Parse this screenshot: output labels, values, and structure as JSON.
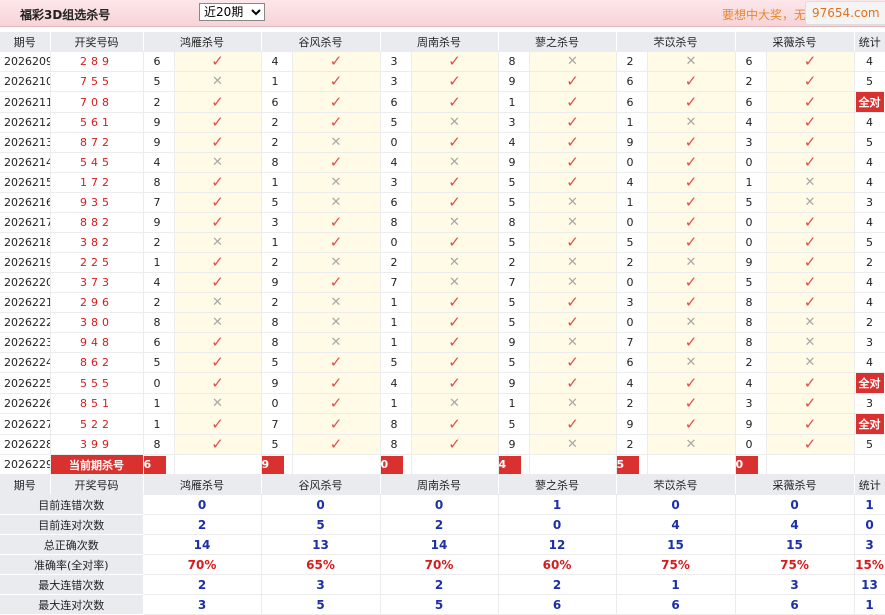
{
  "title": "福彩3D组选杀号",
  "period_options": [
    "近20期"
  ],
  "period_selected": "近20期",
  "slogan": "要想中大奖，无",
  "site_badge": "97654.com",
  "colors": {
    "check": "#e04e4e",
    "cross": "#a8a8a8",
    "highlight": "#d9312f",
    "stat_value": "#1c2fa7",
    "rate": "#d71b1b"
  },
  "headers": {
    "issue": "期号",
    "numbers": "开奖号码",
    "experts": [
      "鸿雁杀号",
      "谷风杀号",
      "周南杀号",
      "蓼之杀号",
      "芣苡杀号",
      "采薇杀号"
    ],
    "stat": "统计"
  },
  "rows": [
    {
      "issue": "2026209",
      "numbers": "289",
      "kills": [
        "6",
        "4",
        "3",
        "8",
        "2",
        "6"
      ],
      "hits": [
        1,
        1,
        1,
        0,
        0,
        1
      ],
      "stat": "4"
    },
    {
      "issue": "2026210",
      "numbers": "755",
      "kills": [
        "5",
        "1",
        "3",
        "9",
        "6",
        "2"
      ],
      "hits": [
        0,
        1,
        1,
        1,
        1,
        1
      ],
      "stat": "5"
    },
    {
      "issue": "2026211",
      "numbers": "708",
      "kills": [
        "2",
        "6",
        "6",
        "1",
        "6",
        "6"
      ],
      "hits": [
        1,
        1,
        1,
        1,
        1,
        1
      ],
      "stat": "全对"
    },
    {
      "issue": "2026212",
      "numbers": "561",
      "kills": [
        "9",
        "2",
        "5",
        "3",
        "1",
        "4"
      ],
      "hits": [
        1,
        1,
        0,
        1,
        0,
        1
      ],
      "stat": "4"
    },
    {
      "issue": "2026213",
      "numbers": "872",
      "kills": [
        "9",
        "2",
        "0",
        "4",
        "9",
        "3"
      ],
      "hits": [
        1,
        0,
        1,
        1,
        1,
        1
      ],
      "stat": "5"
    },
    {
      "issue": "2026214",
      "numbers": "545",
      "kills": [
        "4",
        "8",
        "4",
        "9",
        "0",
        "0"
      ],
      "hits": [
        0,
        1,
        0,
        1,
        1,
        1
      ],
      "stat": "4"
    },
    {
      "issue": "2026215",
      "numbers": "172",
      "kills": [
        "8",
        "1",
        "3",
        "5",
        "4",
        "1"
      ],
      "hits": [
        1,
        0,
        1,
        1,
        1,
        0
      ],
      "stat": "4"
    },
    {
      "issue": "2026216",
      "numbers": "935",
      "kills": [
        "7",
        "5",
        "6",
        "5",
        "1",
        "5"
      ],
      "hits": [
        1,
        0,
        1,
        0,
        1,
        0
      ],
      "stat": "3"
    },
    {
      "issue": "2026217",
      "numbers": "882",
      "kills": [
        "9",
        "3",
        "8",
        "8",
        "0",
        "0"
      ],
      "hits": [
        1,
        1,
        0,
        0,
        1,
        1
      ],
      "stat": "4"
    },
    {
      "issue": "2026218",
      "numbers": "382",
      "kills": [
        "2",
        "1",
        "0",
        "5",
        "5",
        "0"
      ],
      "hits": [
        0,
        1,
        1,
        1,
        1,
        1
      ],
      "stat": "5"
    },
    {
      "issue": "2026219",
      "numbers": "225",
      "kills": [
        "1",
        "2",
        "2",
        "2",
        "2",
        "9"
      ],
      "hits": [
        1,
        0,
        0,
        0,
        0,
        1
      ],
      "stat": "2"
    },
    {
      "issue": "2026220",
      "numbers": "373",
      "kills": [
        "4",
        "9",
        "7",
        "7",
        "0",
        "5"
      ],
      "hits": [
        1,
        1,
        0,
        0,
        1,
        1
      ],
      "stat": "4"
    },
    {
      "issue": "2026221",
      "numbers": "296",
      "kills": [
        "2",
        "2",
        "1",
        "5",
        "3",
        "8"
      ],
      "hits": [
        0,
        0,
        1,
        1,
        1,
        1
      ],
      "stat": "4"
    },
    {
      "issue": "2026222",
      "numbers": "380",
      "kills": [
        "8",
        "8",
        "1",
        "5",
        "0",
        "8"
      ],
      "hits": [
        0,
        0,
        1,
        1,
        0,
        0
      ],
      "stat": "2"
    },
    {
      "issue": "2026223",
      "numbers": "948",
      "kills": [
        "6",
        "8",
        "1",
        "9",
        "7",
        "8"
      ],
      "hits": [
        1,
        0,
        1,
        0,
        1,
        0
      ],
      "stat": "3"
    },
    {
      "issue": "2026224",
      "numbers": "862",
      "kills": [
        "5",
        "5",
        "5",
        "5",
        "6",
        "2"
      ],
      "hits": [
        1,
        1,
        1,
        1,
        0,
        0
      ],
      "stat": "4"
    },
    {
      "issue": "2026225",
      "numbers": "555",
      "kills": [
        "0",
        "9",
        "4",
        "9",
        "4",
        "4"
      ],
      "hits": [
        1,
        1,
        1,
        1,
        1,
        1
      ],
      "stat": "全对"
    },
    {
      "issue": "2026226",
      "numbers": "851",
      "kills": [
        "1",
        "0",
        "1",
        "1",
        "2",
        "3"
      ],
      "hits": [
        0,
        1,
        0,
        0,
        1,
        1
      ],
      "stat": "3"
    },
    {
      "issue": "2026227",
      "numbers": "522",
      "kills": [
        "1",
        "7",
        "8",
        "5",
        "9",
        "9"
      ],
      "hits": [
        1,
        1,
        1,
        1,
        1,
        1
      ],
      "stat": "全对"
    },
    {
      "issue": "2026228",
      "numbers": "399",
      "kills": [
        "8",
        "5",
        "8",
        "9",
        "2",
        "0"
      ],
      "hits": [
        1,
        1,
        1,
        0,
        0,
        1
      ],
      "stat": "5"
    }
  ],
  "current": {
    "issue": "2026229",
    "label": "当前期杀号",
    "kills": [
      "6",
      "9",
      "0",
      "4",
      "5",
      "0"
    ]
  },
  "summary": [
    {
      "label": "目前连错次数",
      "values": [
        "0",
        "0",
        "0",
        "1",
        "0",
        "0"
      ],
      "stat": "1",
      "red": false
    },
    {
      "label": "目前连对次数",
      "values": [
        "2",
        "5",
        "2",
        "0",
        "4",
        "4"
      ],
      "stat": "0",
      "red": false
    },
    {
      "label": "总正确次数",
      "values": [
        "14",
        "13",
        "14",
        "12",
        "15",
        "15"
      ],
      "stat": "3",
      "red": false
    },
    {
      "label": "准确率(全对率)",
      "values": [
        "70%",
        "65%",
        "70%",
        "60%",
        "75%",
        "75%"
      ],
      "stat": "15%",
      "red": true
    },
    {
      "label": "最大连错次数",
      "values": [
        "2",
        "3",
        "2",
        "2",
        "1",
        "3"
      ],
      "stat": "13",
      "red": false
    },
    {
      "label": "最大连对次数",
      "values": [
        "3",
        "5",
        "5",
        "6",
        "6",
        "6"
      ],
      "stat": "1",
      "red": false
    }
  ]
}
